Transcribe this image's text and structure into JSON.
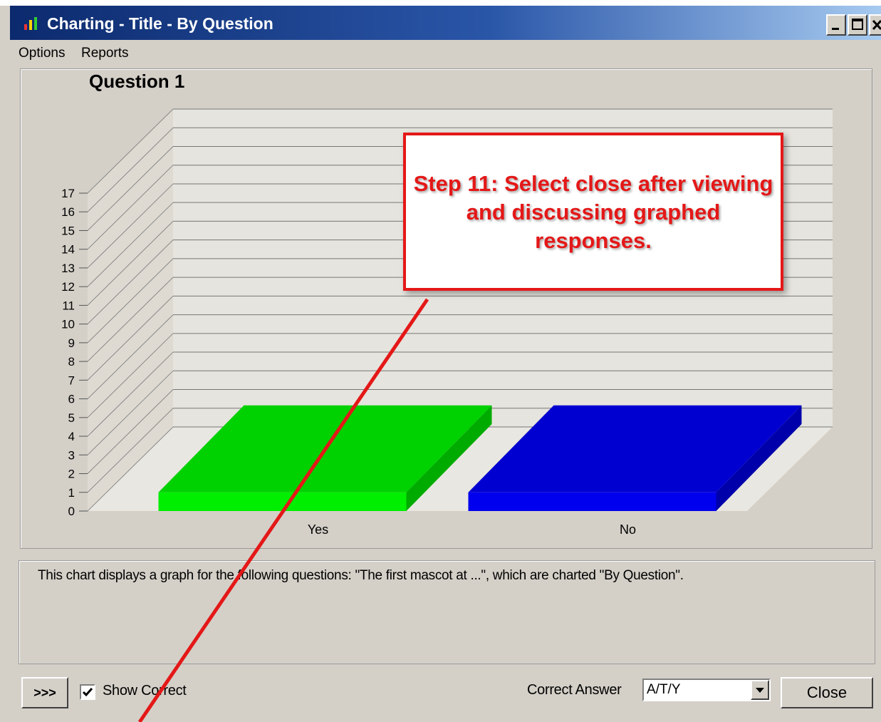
{
  "window": {
    "title": "Charting - Title - By Question",
    "titlebar_gradient": [
      "#0c2a6e",
      "#a6caf0"
    ]
  },
  "menu": {
    "items": [
      {
        "label": "Options"
      },
      {
        "label": "Reports"
      }
    ]
  },
  "chart_data": {
    "type": "bar",
    "title": "Question 1",
    "categories": [
      "Yes",
      "No"
    ],
    "values": [
      1,
      1
    ],
    "colors": [
      "#00ee00",
      "#0000ee"
    ],
    "ylim": [
      0,
      17
    ],
    "yticks": [
      "0",
      "1",
      "2",
      "3",
      "4",
      "5",
      "6",
      "7",
      "8",
      "9",
      "10",
      "11",
      "12",
      "13",
      "14",
      "15",
      "16",
      "17"
    ],
    "style": "3d",
    "grid": true,
    "legend": "none"
  },
  "description": {
    "text": "This chart displays a graph for the following questions: \"The first mascot at ...\", which are charted \"By Question\"."
  },
  "footer": {
    "expand_label": ">>>",
    "show_correct_label": "Show Correct",
    "show_correct_checked": true,
    "correct_answer_label": "Correct Answer",
    "correct_answer_value": "A/T/Y",
    "close_label": "Close"
  },
  "annotation": {
    "text": "Step 11:  Select close after viewing and discussing graphed responses.",
    "color": "#e41818"
  }
}
